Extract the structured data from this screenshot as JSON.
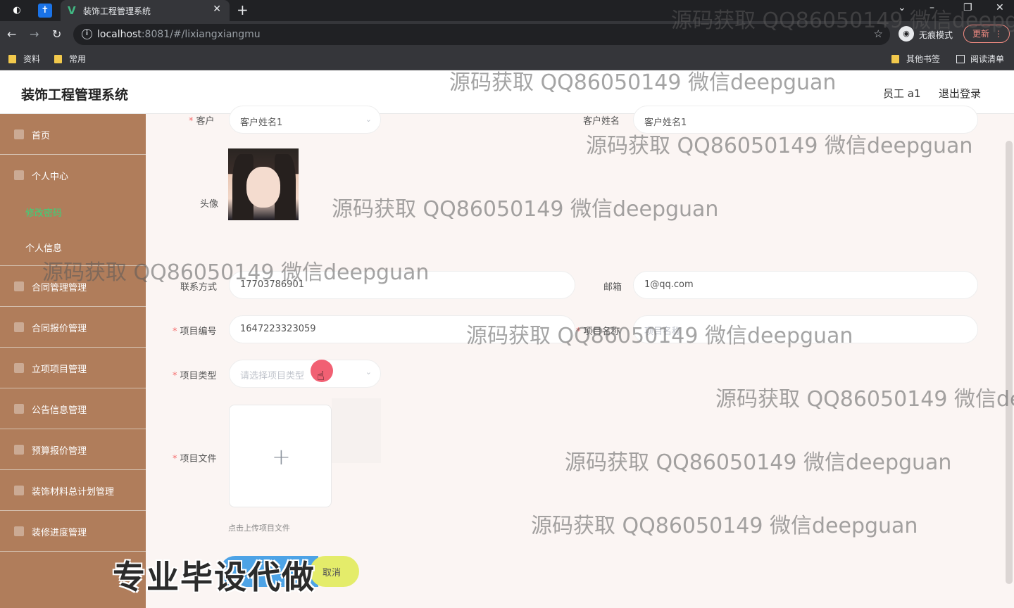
{
  "browser": {
    "tab_title": "装饰工程管理系统",
    "url_host": "localhost",
    "url_rest": ":8081/#/lixiangxiangmu",
    "incognito_label": "无痕模式",
    "update_label": "更新",
    "bookmarks": [
      "资料",
      "常用"
    ],
    "other_bookmarks": "其他书签",
    "reading_list": "阅读清单"
  },
  "header": {
    "title": "装饰工程管理系统",
    "user": "员工 a1",
    "logout": "退出登录"
  },
  "sidebar": {
    "items": [
      {
        "label": "首页"
      },
      {
        "label": "个人中心"
      },
      {
        "label": "合同管理管理"
      },
      {
        "label": "合同报价管理"
      },
      {
        "label": "立项项目管理"
      },
      {
        "label": "公告信息管理"
      },
      {
        "label": "预算报价管理"
      },
      {
        "label": "装饰材料总计划管理"
      },
      {
        "label": "装修进度管理"
      }
    ],
    "sub_items": [
      {
        "label": "修改密码"
      },
      {
        "label": "个人信息"
      }
    ]
  },
  "form": {
    "customer_label": "客户",
    "customer_value": "客户姓名1",
    "customer_name_label": "客户姓名",
    "customer_name_value": "客户姓名1",
    "avatar_label": "头像",
    "contact_label": "联系方式",
    "contact_value": "17703786901",
    "email_label": "邮箱",
    "email_value": "1@qq.com",
    "project_no_label": "项目编号",
    "project_no_value": "1647223323059",
    "project_name_label": "项目名称",
    "project_name_placeholder": "项目名称",
    "project_type_label": "项目类型",
    "project_type_placeholder": "请选择项目类型",
    "project_file_label": "项目文件",
    "upload_tip": "点击上传项目文件",
    "cancel_label": "取消"
  },
  "overlay": {
    "promo": "专业毕设代做",
    "watermark": "源码获取 QQ86050149 微信deepguan"
  }
}
